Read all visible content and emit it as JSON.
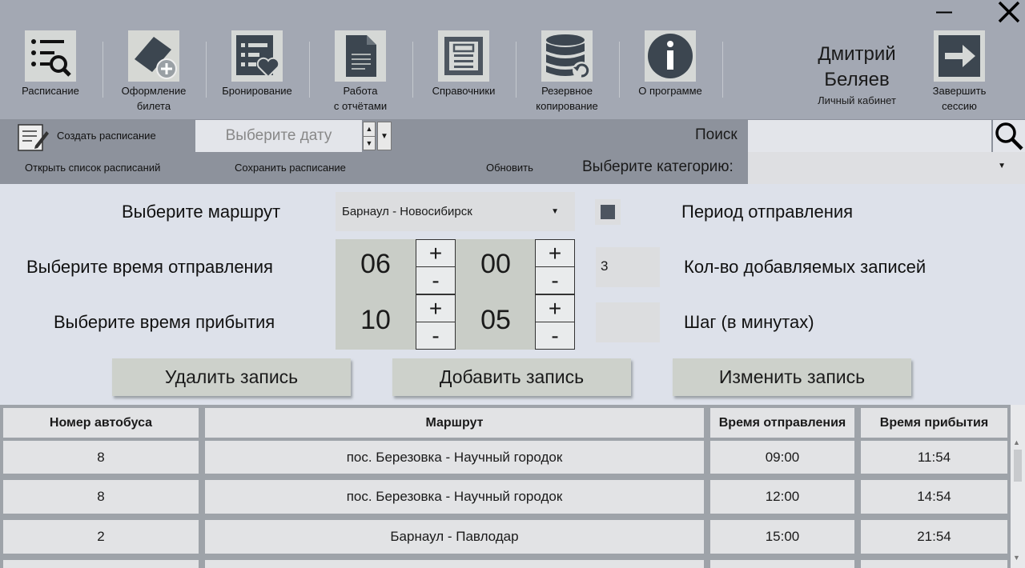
{
  "window": {
    "minimize_glyph": "—",
    "close_glyph": "✕"
  },
  "toolbar": {
    "items": [
      {
        "label": "Расписание",
        "icon": "schedule-search-icon"
      },
      {
        "label": "Оформление\nбилета",
        "icon": "ticket-add-icon"
      },
      {
        "label": "Бронирование",
        "icon": "booking-list-heart-icon"
      },
      {
        "label": "Работа\nс отчётами",
        "icon": "report-document-icon"
      },
      {
        "label": "Справочники",
        "icon": "reference-book-icon"
      },
      {
        "label": "Резервное\nкопирование",
        "icon": "database-backup-icon"
      },
      {
        "label": "О программе",
        "icon": "info-icon"
      }
    ],
    "user": {
      "name": "Дмитрий\nБеляев",
      "cabinet": "Личный кабинет"
    },
    "logout": {
      "label": "Завершить\nсессию",
      "icon": "logout-arrow-icon"
    }
  },
  "schedule_bar": {
    "create": "Создать расписание",
    "open_list": "Открыть список расписаний",
    "save": "Сохранить расписание",
    "refresh": "Обновить",
    "date_placeholder": "Выберите дату",
    "search_label": "Поиск",
    "category_label": "Выберите категорию:"
  },
  "form": {
    "route_label": "Выберите маршрут",
    "route_value": "Барнаул - Новосибирск",
    "period_label": "Период отправления",
    "period_checked": true,
    "departure_label": "Выберите время отправления",
    "arrival_label": "Выберите время прибытия",
    "dep_hour": "06",
    "dep_min": "00",
    "arr_hour": "10",
    "arr_min": "05",
    "plus": "+",
    "minus": "-",
    "count_label": "Кол-во добавляемых записей",
    "count_value": "3",
    "step_label": "Шаг (в минутах)",
    "step_value": "",
    "delete_btn": "Удалить запись",
    "add_btn": "Добавить запись",
    "edit_btn": "Изменить запись"
  },
  "table": {
    "columns": [
      "Номер автобуса",
      "Маршрут",
      "Время отправления",
      "Время прибытия"
    ],
    "rows": [
      [
        "8",
        "пос. Березовка - Научный городок",
        "09:00",
        "11:54"
      ],
      [
        "8",
        "пос. Березовка - Научный городок",
        "12:00",
        "14:54"
      ],
      [
        "2",
        "Барнаул - Павлодар",
        "15:00",
        "21:54"
      ]
    ]
  },
  "colors": {
    "toolbar_bg": "#a3a8b3",
    "band_bg": "#8d929c",
    "content_bg": "#dde1ea",
    "icon_dark": "#3c4650"
  }
}
